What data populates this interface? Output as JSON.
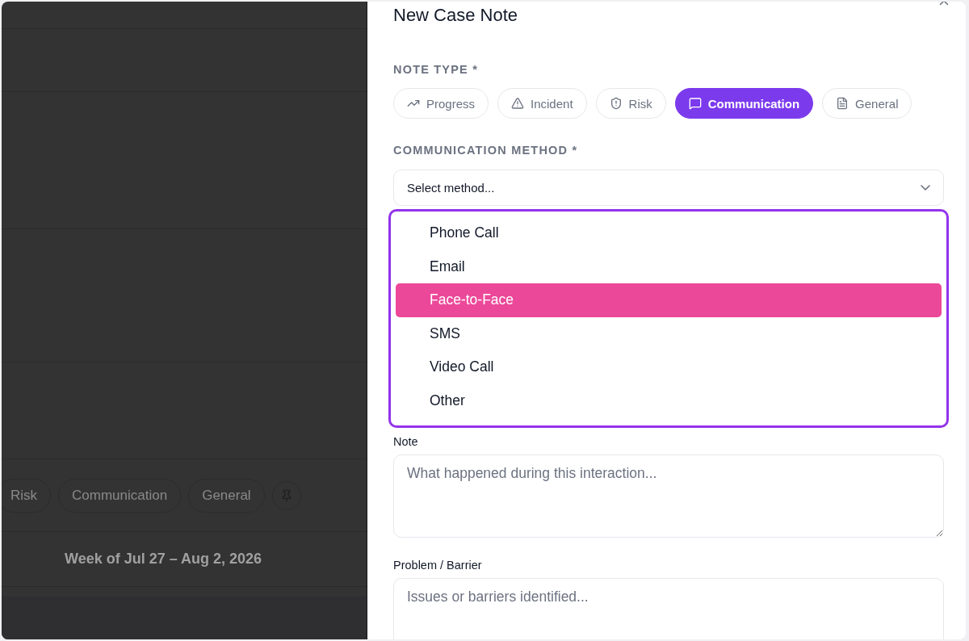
{
  "background": {
    "filter_chips": [
      {
        "label": "Risk"
      },
      {
        "label": "Communication"
      },
      {
        "label": "General"
      }
    ],
    "week_label": "Week of Jul 27 – Aug 2, 2026"
  },
  "dialog": {
    "title": "New Case Note",
    "note_type": {
      "label": "NOTE TYPE *",
      "options": [
        {
          "label": "Progress",
          "selected": false
        },
        {
          "label": "Incident",
          "selected": false
        },
        {
          "label": "Risk",
          "selected": false
        },
        {
          "label": "Communication",
          "selected": true
        },
        {
          "label": "General",
          "selected": false
        }
      ]
    },
    "communication_method": {
      "label": "COMMUNICATION METHOD *",
      "value": "Select method...",
      "expanded": true,
      "options": [
        {
          "label": "Phone Call",
          "selected": false
        },
        {
          "label": "Email",
          "selected": false
        },
        {
          "label": "Face-to-Face",
          "selected": true
        },
        {
          "label": "SMS",
          "selected": false
        },
        {
          "label": "Video Call",
          "selected": false
        },
        {
          "label": "Other",
          "selected": false
        }
      ]
    },
    "note": {
      "label": "Note",
      "placeholder": "What happened during this interaction..."
    },
    "problem": {
      "label": "Problem / Barrier",
      "placeholder": "Issues or barriers identified..."
    }
  }
}
